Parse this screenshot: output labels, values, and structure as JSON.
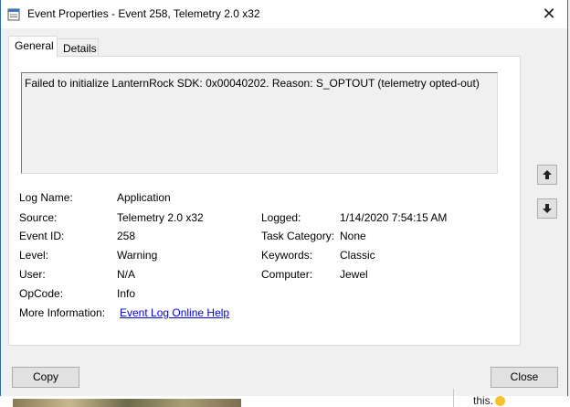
{
  "window": {
    "title": "Event Properties - Event 258, Telemetry 2.0 x32",
    "close_glyph": "✕"
  },
  "tabs": [
    {
      "label": "General",
      "active": true
    },
    {
      "label": "Details",
      "active": false
    }
  ],
  "event": {
    "message": "Failed to initialize LanternRock SDK: 0x00040202. Reason: S_OPTOUT (telemetry opted-out)",
    "fields": {
      "log_name": {
        "label": "Log Name:",
        "value": "Application"
      },
      "source": {
        "label": "Source:",
        "value": "Telemetry 2.0 x32"
      },
      "logged": {
        "label": "Logged:",
        "value": "1/14/2020 7:54:15 AM"
      },
      "event_id": {
        "label": "Event ID:",
        "value": "258"
      },
      "task_category": {
        "label": "Task Category:",
        "value": "None"
      },
      "level": {
        "label": "Level:",
        "value": "Warning"
      },
      "keywords": {
        "label": "Keywords:",
        "value": "Classic"
      },
      "user": {
        "label": "User:",
        "value": "N/A"
      },
      "computer": {
        "label": "Computer:",
        "value": "Jewel"
      },
      "opcode": {
        "label": "OpCode:",
        "value": "Info"
      },
      "more_info": {
        "label": "More Information:",
        "value": "Event Log Online Help"
      }
    }
  },
  "buttons": {
    "copy": "Copy",
    "close": "Close"
  },
  "background": {
    "text": "this."
  },
  "icons": {
    "app": "event-viewer-icon",
    "up": "arrow-up-icon",
    "down": "arrow-down-icon",
    "close": "close-icon"
  },
  "colors": {
    "link": "#0000ee",
    "window_border": "#2b6fa6"
  }
}
